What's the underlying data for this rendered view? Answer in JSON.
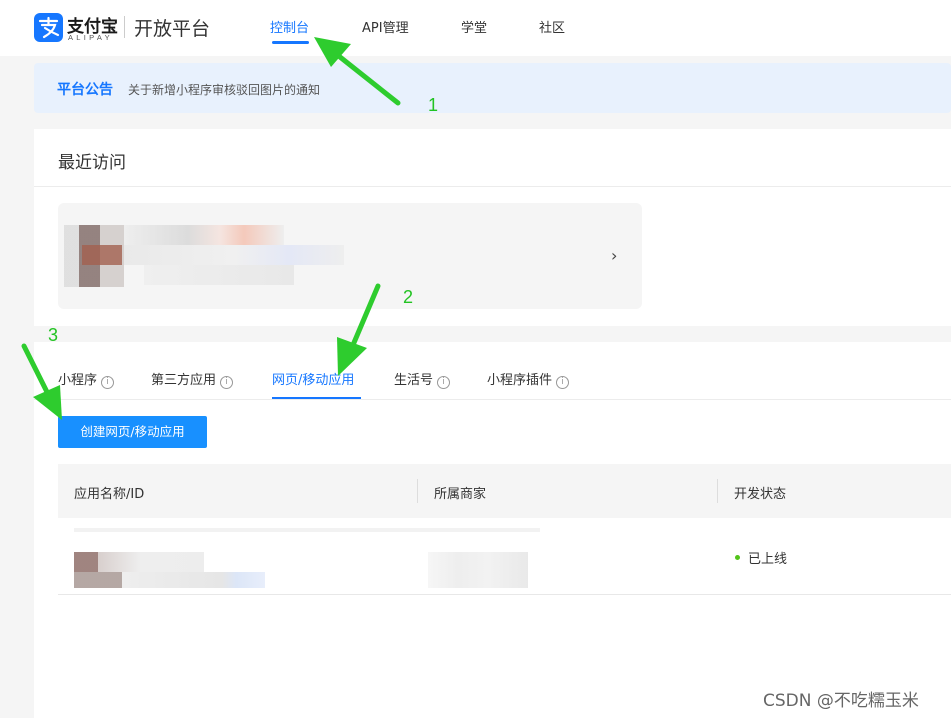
{
  "header": {
    "logo_cn": "支付宝",
    "logo_en": "ALIPAY",
    "platform": "开放平台",
    "nav": [
      {
        "label": "控制台",
        "active": true
      },
      {
        "label": "API管理",
        "active": false
      },
      {
        "label": "学堂",
        "active": false
      },
      {
        "label": "社区",
        "active": false
      }
    ]
  },
  "notice": {
    "label": "平台公告",
    "text": "关于新增小程序审核驳回图片的通知"
  },
  "recent": {
    "title": "最近访问",
    "chevron": "›"
  },
  "apps": {
    "tabs": [
      {
        "label": "小程序",
        "info": true,
        "active": false
      },
      {
        "label": "第三方应用",
        "info": true,
        "active": false
      },
      {
        "label": "网页/移动应用",
        "info": false,
        "active": true
      },
      {
        "label": "生活号",
        "info": true,
        "active": false
      },
      {
        "label": "小程序插件",
        "info": true,
        "active": false
      }
    ],
    "info_glyph": "i",
    "create_button": "创建网页/移动应用",
    "table": {
      "columns": [
        "应用名称/ID",
        "所属商家",
        "开发状态"
      ],
      "rows": [
        {
          "status": "已上线"
        }
      ]
    }
  },
  "annotations": {
    "labels": [
      "1",
      "2",
      "3"
    ],
    "color": "#22c322"
  },
  "watermark": "CSDN @不吃糯玉米",
  "colors": {
    "brand": "#1677ff",
    "button": "#1890ff",
    "notice_bg": "#e8f1fd",
    "status_online": "#52c41a"
  }
}
